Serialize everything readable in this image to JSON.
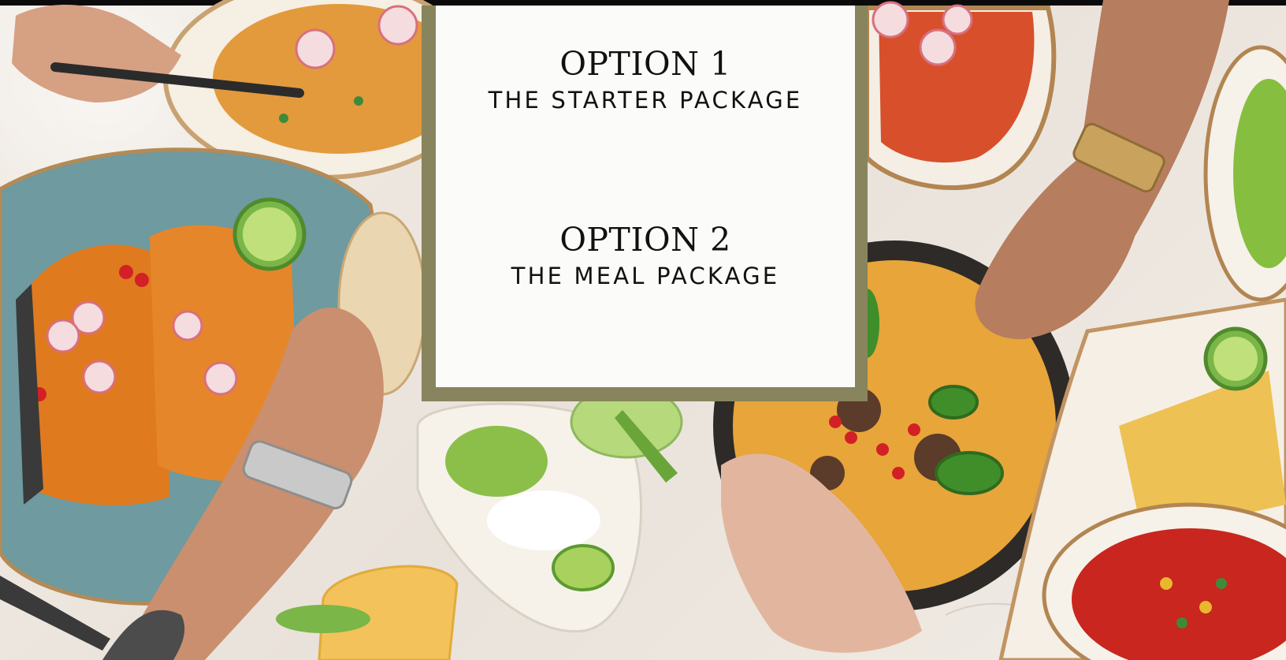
{
  "options": [
    {
      "heading": "OPTION 1",
      "subtitle": "THE STARTER PACKAGE"
    },
    {
      "heading": "OPTION 2",
      "subtitle": "THE MEAL PACKAGE"
    }
  ],
  "colors": {
    "frame": "#88845d",
    "card": "#ffffff",
    "text": "#111111",
    "top_bar": "#0b0b0b"
  }
}
